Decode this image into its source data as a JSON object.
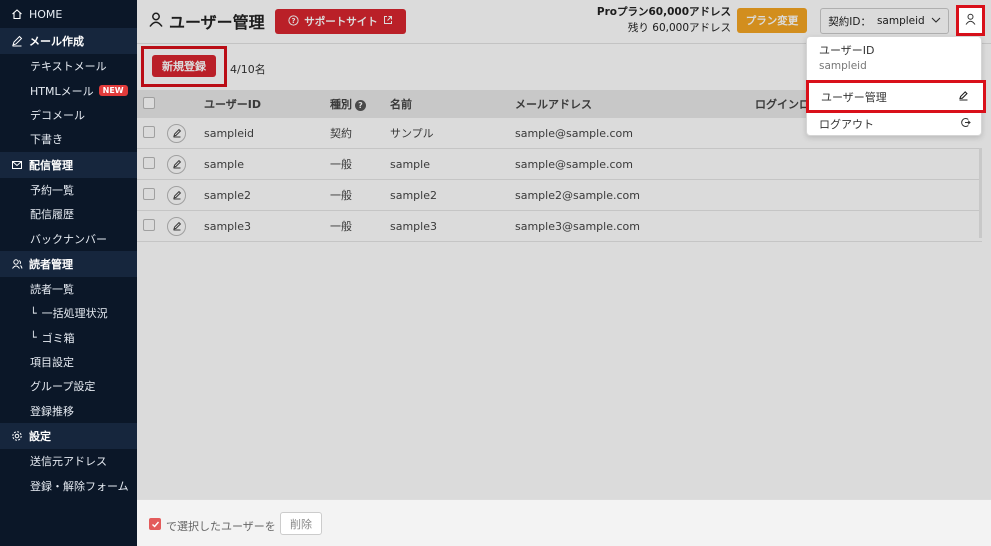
{
  "sidebar": {
    "home": "HOME",
    "sections": [
      {
        "title": "メール作成",
        "icon": "pencil-icon",
        "items": [
          {
            "label": "テキストメール"
          },
          {
            "label": "HTMLメール",
            "badge": "NEW"
          },
          {
            "label": "デコメール"
          },
          {
            "label": "下書き"
          }
        ]
      },
      {
        "title": "配信管理",
        "icon": "mail-icon",
        "items": [
          {
            "label": "予約一覧"
          },
          {
            "label": "配信履歴"
          },
          {
            "label": "バックナンバー"
          }
        ]
      },
      {
        "title": "読者管理",
        "icon": "users-icon",
        "items": [
          {
            "label": "読者一覧"
          },
          {
            "label": "一括処理状況",
            "prefix": "└"
          },
          {
            "label": "ゴミ箱",
            "prefix": "└"
          },
          {
            "label": "項目設定"
          },
          {
            "label": "グループ設定"
          },
          {
            "label": "登録推移"
          }
        ]
      },
      {
        "title": "設定",
        "icon": "gear-icon",
        "items": [
          {
            "label": "送信元アドレス"
          },
          {
            "label": "登録・解除フォーム"
          }
        ]
      }
    ]
  },
  "header": {
    "title": "ユーザー管理",
    "support_label": "サポートサイト",
    "plan_line1": "Proプラン60,000アドレス",
    "plan_line2": "残り 60,000アドレス",
    "plan_change_label": "プラン変更",
    "contract_label": "契約ID：",
    "contract_id": "sampleid"
  },
  "toolbar": {
    "register_label": "新規登録",
    "count": "4/10名"
  },
  "table": {
    "headers": {
      "id": "ユーザーID",
      "type": "種別",
      "name": "名前",
      "mail": "メールアドレス",
      "login": "ログインロ"
    },
    "rows": [
      {
        "id": "sampleid",
        "type": "契約",
        "name": "サンプル",
        "mail": "sample@sample.com"
      },
      {
        "id": "sample",
        "type": "一般",
        "name": "sample",
        "mail": "sample@sample.com"
      },
      {
        "id": "sample2",
        "type": "一般",
        "name": "sample2",
        "mail": "sample2@sample.com"
      },
      {
        "id": "sample3",
        "type": "一般",
        "name": "sample3",
        "mail": "sample3@sample.com"
      }
    ]
  },
  "footer": {
    "bulk_text": "で選択したユーザーを",
    "delete_label": "削除"
  },
  "dropdown": {
    "id_label": "ユーザーID",
    "id_value": "sampleid",
    "manage_label": "ユーザー管理",
    "logout_label": "ログアウト"
  },
  "colors": {
    "sidebar_bg": "#0b1728",
    "accent_red": "#d9262f",
    "plan_orange": "#f5a623",
    "highlight_border": "#d9101a"
  }
}
